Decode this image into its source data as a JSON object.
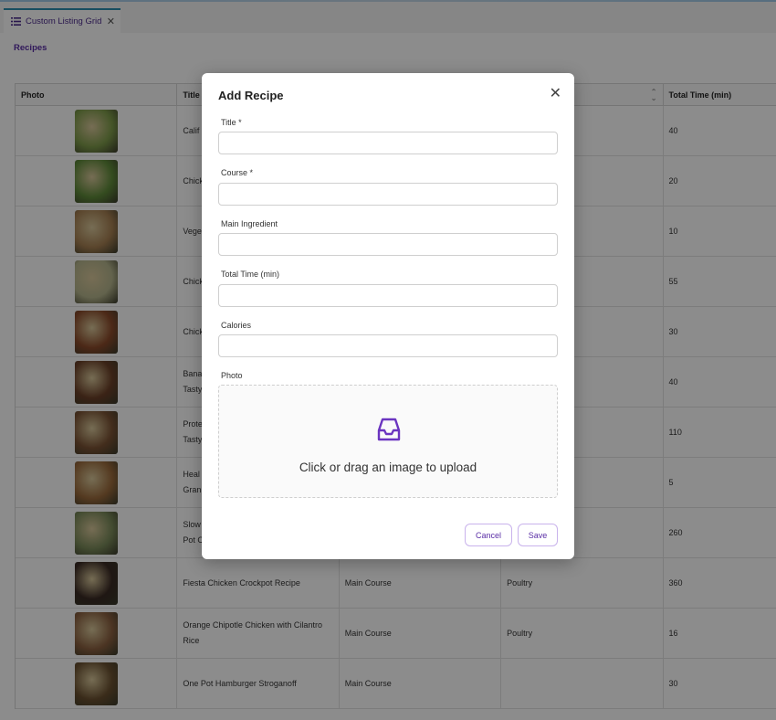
{
  "tab": {
    "label": "Custom Listing Grid",
    "icon": "list-icon",
    "close_icon": "close-icon"
  },
  "breadcrumb": "Recipes",
  "grid": {
    "columns": [
      "Photo",
      "Title",
      "",
      "",
      "Total Time (min)"
    ],
    "rows": [
      {
        "title": "Calif",
        "course": "",
        "ingredient": "",
        "time": "40",
        "color": "#7d9a4a"
      },
      {
        "title": "Chick",
        "course": "",
        "ingredient": "",
        "time": "20",
        "color": "#5f8a3a"
      },
      {
        "title": "Vege",
        "course": "",
        "ingredient": "",
        "time": "10",
        "color": "#a57f52"
      },
      {
        "title": "Chick",
        "course": "",
        "ingredient": "",
        "time": "55",
        "color": "#b4b48c"
      },
      {
        "title": "Chick",
        "course": "",
        "ingredient": "",
        "time": "30",
        "color": "#8a4a2a"
      },
      {
        "title": "Bana\nTasty",
        "course": "",
        "ingredient": "",
        "time": "40",
        "color": "#6b4028"
      },
      {
        "title": "Prote\nTasty",
        "course": "",
        "ingredient": "",
        "time": "110",
        "color": "#7a5234"
      },
      {
        "title": "Heal\nGran",
        "course": "",
        "ingredient": "",
        "time": "5",
        "color": "#9a6a3c"
      },
      {
        "title": "Slow\nPot C",
        "course": "",
        "ingredient": "",
        "time": "260",
        "color": "#7a8a5a"
      },
      {
        "title": "Fiesta Chicken Crockpot Recipe",
        "course": "Main Course",
        "ingredient": "Poultry",
        "time": "360",
        "color": "#3a2a24"
      },
      {
        "title": "Orange Chipotle Chicken with Cilantro Rice",
        "course": "Main Course",
        "ingredient": "Poultry",
        "time": "16",
        "color": "#8a6040"
      },
      {
        "title": "One Pot Hamburger Stroganoff",
        "course": "Main Course",
        "ingredient": "",
        "time": "30",
        "color": "#6a5030"
      }
    ]
  },
  "modal": {
    "title": "Add Recipe",
    "close_icon": "close-icon",
    "fields": [
      {
        "label": "Title *",
        "value": ""
      },
      {
        "label": "Course *",
        "value": ""
      },
      {
        "label": "Main Ingredient",
        "value": ""
      },
      {
        "label": "Total Time (min)",
        "value": ""
      },
      {
        "label": "Calories",
        "value": ""
      }
    ],
    "photo_label": "Photo",
    "upload_icon": "inbox-icon",
    "upload_text": "Click or drag an image to upload",
    "cancel_label": "Cancel",
    "save_label": "Save"
  },
  "colors": {
    "accent": "#5a2ea6",
    "tab_border": "#2b8fb0"
  }
}
